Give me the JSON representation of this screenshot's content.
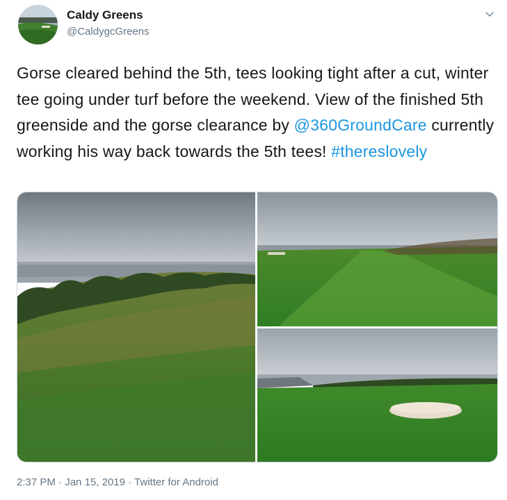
{
  "account": {
    "display_name": "Caldy Greens",
    "handle": "@CaldygcGreens",
    "avatar_icon": "avatar-golf-course-photo"
  },
  "tweet": {
    "text_before": "Gorse cleared behind the 5th, tees looking tight after a cut, winter tee going under turf before the weekend. View of the finished 5th greenside and the gorse clearance by ",
    "mention": "@360GroundCare",
    "text_middle": " currently working his way back towards the 5th tees! ",
    "hashtag": "#thereslovely"
  },
  "media": {
    "photos": [
      {
        "name": "photo-gorse-clearance"
      },
      {
        "name": "photo-5th-tees"
      },
      {
        "name": "photo-5th-greenside"
      }
    ]
  },
  "meta": {
    "time": "2:37 PM",
    "date": "Jan 15, 2019",
    "source": "Twitter for Android",
    "separator": " · "
  },
  "colors": {
    "link": "#1b95e0",
    "secondary_text": "#657786",
    "border": "#ccd6dd"
  },
  "icons": {
    "menu": "chevron-down-icon"
  }
}
